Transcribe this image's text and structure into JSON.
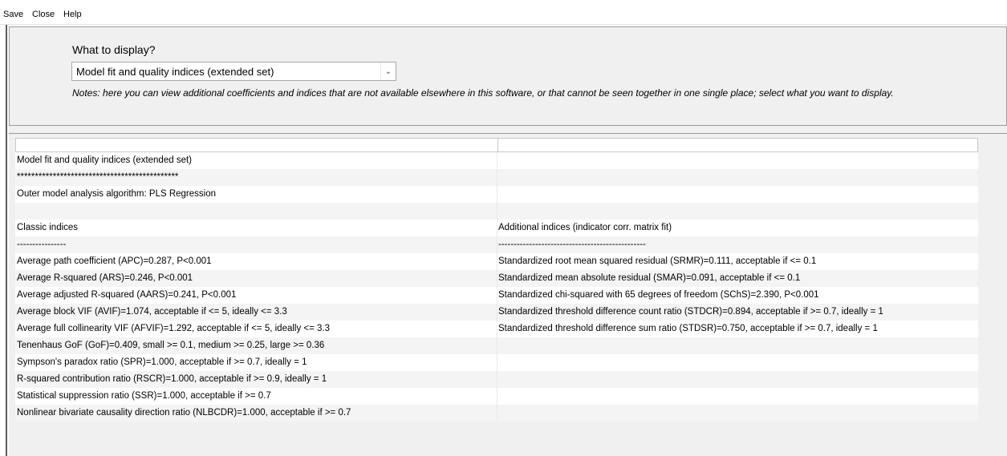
{
  "menu": {
    "save": "Save",
    "close": "Close",
    "help": "Help"
  },
  "display": {
    "prompt": "What to display?",
    "selected": "Model fit and quality indices (extended set)",
    "notes": "Notes: here you can view additional coefficients and indices that are not available elsewhere in this software, or that cannot be seen together in one single place; select what you want to display."
  },
  "rows": [
    [
      "Model fit and quality indices (extended set)",
      ""
    ],
    [
      "*********************************************",
      ""
    ],
    [
      "Outer model analysis algorithm: PLS Regression",
      ""
    ],
    [
      "",
      ""
    ],
    [
      "Classic indices",
      "Additional indices (indicator corr. matrix fit)"
    ],
    [
      "----------------",
      "------------------------------------------------"
    ],
    [
      "Average path coefficient (APC)=0.287, P<0.001",
      "Standardized root mean squared residual (SRMR)=0.111, acceptable if <= 0.1"
    ],
    [
      "Average R-squared (ARS)=0.246, P<0.001",
      "Standardized mean absolute residual (SMAR)=0.091, acceptable if <= 0.1"
    ],
    [
      "Average adjusted R-squared (AARS)=0.241, P<0.001",
      "Standardized chi-squared with 65 degrees of freedom (SChS)=2.390, P<0.001"
    ],
    [
      "Average block VIF (AVIF)=1.074, acceptable if <= 5, ideally <= 3.3",
      "Standardized threshold difference count ratio (STDCR)=0.894, acceptable if >= 0.7, ideally = 1"
    ],
    [
      "Average full collinearity VIF (AFVIF)=1.292, acceptable if <= 5, ideally <= 3.3",
      "Standardized threshold difference sum ratio (STDSR)=0.750, acceptable if >= 0.7, ideally = 1"
    ],
    [
      "Tenenhaus GoF (GoF)=0.409, small >= 0.1, medium >= 0.25, large >= 0.36",
      ""
    ],
    [
      "Sympson's paradox ratio (SPR)=1.000, acceptable if >= 0.7, ideally = 1",
      ""
    ],
    [
      "R-squared contribution ratio (RSCR)=1.000, acceptable if >= 0.9, ideally = 1",
      ""
    ],
    [
      "Statistical suppression ratio (SSR)=1.000, acceptable if >= 0.7",
      ""
    ],
    [
      "Nonlinear bivariate causality direction ratio (NLBCDR)=1.000, acceptable if >= 0.7",
      ""
    ]
  ]
}
